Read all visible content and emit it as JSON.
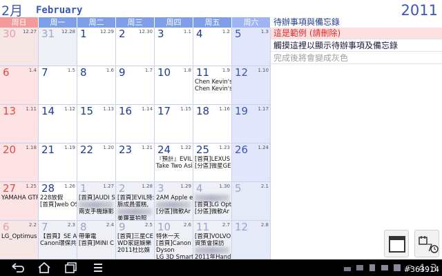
{
  "header": {
    "month_cn": "2月",
    "month_en": "February",
    "year": "2011"
  },
  "weekdays": [
    "周日",
    "周一",
    "周二",
    "周三",
    "周四",
    "周五",
    "周六"
  ],
  "weeks": [
    [
      {
        "day": "30",
        "lunar": "12.27",
        "other": true,
        "events": []
      },
      {
        "day": "31",
        "lunar": "12.28",
        "other": true,
        "events": []
      },
      {
        "day": "1",
        "lunar": "12.29",
        "events": []
      },
      {
        "day": "2",
        "lunar": "12.30",
        "events": []
      },
      {
        "day": "3",
        "lunar": "1.1",
        "events": []
      },
      {
        "day": "4",
        "lunar": "1.2",
        "events": []
      },
      {
        "day": "5",
        "lunar": "1.3",
        "events": []
      }
    ],
    [
      {
        "day": "6",
        "lunar": "1.4",
        "events": []
      },
      {
        "day": "7",
        "lunar": "1.5",
        "events": []
      },
      {
        "day": "8",
        "lunar": "1.6",
        "events": []
      },
      {
        "day": "9",
        "lunar": "1.7",
        "events": []
      },
      {
        "day": "10",
        "lunar": "1.8",
        "events": []
      },
      {
        "day": "11",
        "lunar": "1.9",
        "events": [
          "Chen Kevin's",
          "Chen Kevin's"
        ]
      },
      {
        "day": "12",
        "lunar": "1.10",
        "events": []
      }
    ],
    [
      {
        "day": "13",
        "lunar": "1.11",
        "events": []
      },
      {
        "day": "14",
        "lunar": "1.12",
        "events": []
      },
      {
        "day": "15",
        "lunar": "1.13",
        "events": []
      },
      {
        "day": "16",
        "lunar": "1.14",
        "events": []
      },
      {
        "day": "17",
        "lunar": "1.15",
        "events": []
      },
      {
        "day": "18",
        "lunar": "1.16",
        "events": []
      },
      {
        "day": "19",
        "lunar": "1.17",
        "events": []
      }
    ],
    [
      {
        "day": "20",
        "lunar": "1.18",
        "events": []
      },
      {
        "day": "21",
        "lunar": "1.19",
        "events": []
      },
      {
        "day": "22",
        "lunar": "1.20",
        "events": []
      },
      {
        "day": "23",
        "lunar": "1.21",
        "events": []
      },
      {
        "day": "24",
        "lunar": "1.22",
        "events": [
          "『預計』EVIL",
          "Take Two Asi"
        ]
      },
      {
        "day": "25",
        "lunar": "1.23",
        "events": [
          "[首頁]LEXUS",
          "[分區]微星GE"
        ]
      },
      {
        "day": "26",
        "lunar": "1.24",
        "events": []
      }
    ],
    [
      {
        "day": "27",
        "lunar": "1.25",
        "events": [
          "YAMAHA GTR"
        ]
      },
      {
        "day": "28",
        "lunar": "1.26",
        "events": [
          "228放假",
          "[首頁]web OS"
        ]
      },
      {
        "day": "1",
        "lunar": "1.27",
        "other": true,
        "events": [
          "[首頁]AUDI S",
          "",
          "兩支手機錄影"
        ]
      },
      {
        "day": "2",
        "lunar": "1.28",
        "other": true,
        "events": [
          "[首頁]EVIL特:",
          "脈成員蛋糕,",
          "",
          "美羅華拍照"
        ]
      },
      {
        "day": "3",
        "lunar": "1.29",
        "other": true,
        "events": [
          "2AM Apple e",
          "",
          "[分區]微軟Ar"
        ]
      },
      {
        "day": "4",
        "lunar": "1.30",
        "other": true,
        "events": [
          "",
          "[首頁]LG Opt",
          "[分區]微軟Ar"
        ]
      },
      {
        "day": "5",
        "lunar": "2.1",
        "other": true,
        "events": []
      }
    ],
    [
      {
        "day": "6",
        "lunar": "2.2",
        "other": true,
        "events": [
          "LG_Optimus"
        ]
      },
      {
        "day": "7",
        "lunar": "2.3",
        "other": true,
        "events": [
          "【首頁】SE A",
          "Canon環保共"
        ]
      },
      {
        "day": "8",
        "lunar": "2.4",
        "other": true,
        "events": [
          "帶筆電",
          "[首頁]MINI C"
        ]
      },
      {
        "day": "9",
        "lunar": "2.5",
        "other": true,
        "events": [
          "[首頁]三星CE",
          "WD家庭娛樂",
          "2011杜比娛"
        ]
      },
      {
        "day": "10",
        "lunar": "2.6",
        "other": true,
        "events": [
          "特休一天",
          "[首頁]Canon",
          "Dyson",
          "LG 3D Smart"
        ]
      },
      {
        "day": "11",
        "lunar": "2.7",
        "other": true,
        "events": [
          "[首頁]VOLVO",
          "資策會採訪",
          "",
          "2011年Hand"
        ]
      },
      {
        "day": "12",
        "lunar": "2.8",
        "other": true,
        "events": []
      }
    ]
  ],
  "todo": {
    "title": "待辦事項與備忘錄",
    "items": [
      "這是範例 (請刪除)",
      "觸摸這裡以顯示待辦事項及備忘錄",
      "完成後將會變成灰色"
    ]
  },
  "statusbar": {
    "clock": "4:3",
    "watermark": "#363914"
  }
}
